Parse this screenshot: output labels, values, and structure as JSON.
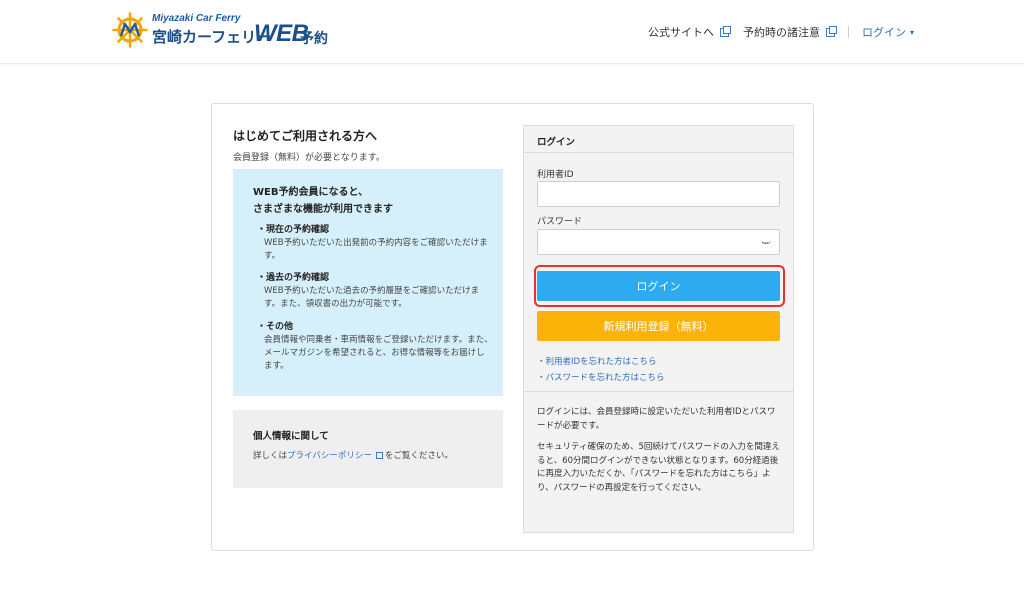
{
  "header": {
    "logo_sub": "Miyazaki Car Ferry",
    "logo_main": "宮崎カーフェリー",
    "logo_web": "WEB",
    "logo_yoyaku": "予約",
    "nav": {
      "official_site": "公式サイトへ",
      "notes": "予約時の諸注意",
      "login": "ログイン"
    },
    "icons": [
      "external-link-icon",
      "chevron-down-icon",
      "ship-wheel-logo-icon"
    ],
    "brand_color": "#1b4f8a"
  },
  "left": {
    "title": "はじめてご利用される方へ",
    "desc": "会員登録（無料）が必要となります。",
    "benefits": {
      "head_line1": "WEB予約会員になると、",
      "head_line2": "さまざまな機能が利用できます",
      "items": [
        {
          "title": "・現在の予約確認",
          "text": "WEB予約いただいた出発前の予約内容をご確認いただけます。"
        },
        {
          "title": "・過去の予約確認",
          "text": "WEB予約いただいた過去の予約履歴をご確認いただけます。また、領収書の出力が可能です。"
        },
        {
          "title": "・その他",
          "text": "会員情報や同乗者・車両情報をご登録いただけます。また、メールマガジンを希望されると、お得な情報等をお届けします。"
        }
      ],
      "bg_color": "#d6f0fb"
    },
    "privacy": {
      "title": "個人情報に関して",
      "text_before": "詳しくは",
      "link": "プライバシーポリシー",
      "text_after": "をご覧ください。"
    }
  },
  "login": {
    "header": "ログイン",
    "user_id_label": "利用者ID",
    "user_id_value": "",
    "password_label": "パスワード",
    "password_value": "",
    "login_button": "ログイン",
    "register_button": "新規利用登録（無料）",
    "forgot_id": "・利用者IDを忘れた方はこちら",
    "forgot_password": "・パスワードを忘れた方はこちら",
    "note1": "ログインには、会員登録時に設定いただいた利用者IDとパスワードが必要です。",
    "note2": "セキュリティ確保のため、5回続けてパスワードの入力を間違えると、60分間ログインができない状態となります。60分経過後に再度入力いただくか、「パスワードを忘れた方はこちら」より、パスワードの再設定を行ってください。",
    "login_button_color": "#2eaaf0",
    "register_button_color": "#fbb309",
    "highlight_color": "#e5322d"
  }
}
